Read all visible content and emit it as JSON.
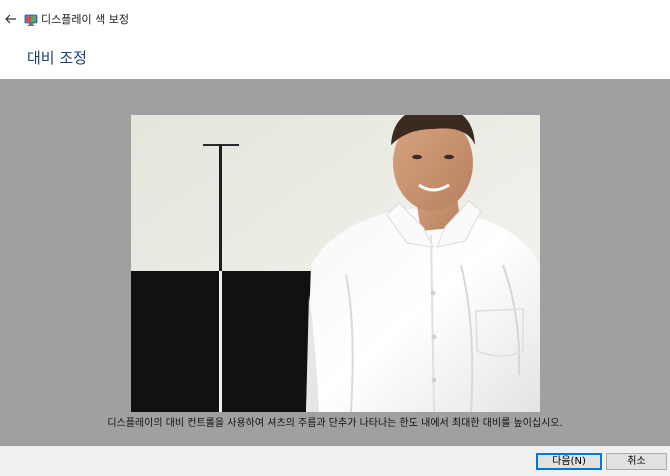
{
  "window": {
    "title": "디스플레이 색 보정",
    "back_icon": "back-arrow-icon",
    "app_icon": "display-calibration-icon"
  },
  "header": {
    "title": "대비 조정"
  },
  "content": {
    "image_description_icon": "contrast-reference-photo",
    "instruction": "디스플레이의 대비 컨트롤을 사용하여 셔츠의 주름과 단추가 나타나는 한도 내에서 최대한 대비를 높이십시오."
  },
  "footer": {
    "next_label": "다음(N)",
    "cancel_label": "취소"
  },
  "colors": {
    "title_blue": "#1e3f73",
    "content_gray": "#a0a0a0",
    "default_button_border": "#0078d7"
  }
}
